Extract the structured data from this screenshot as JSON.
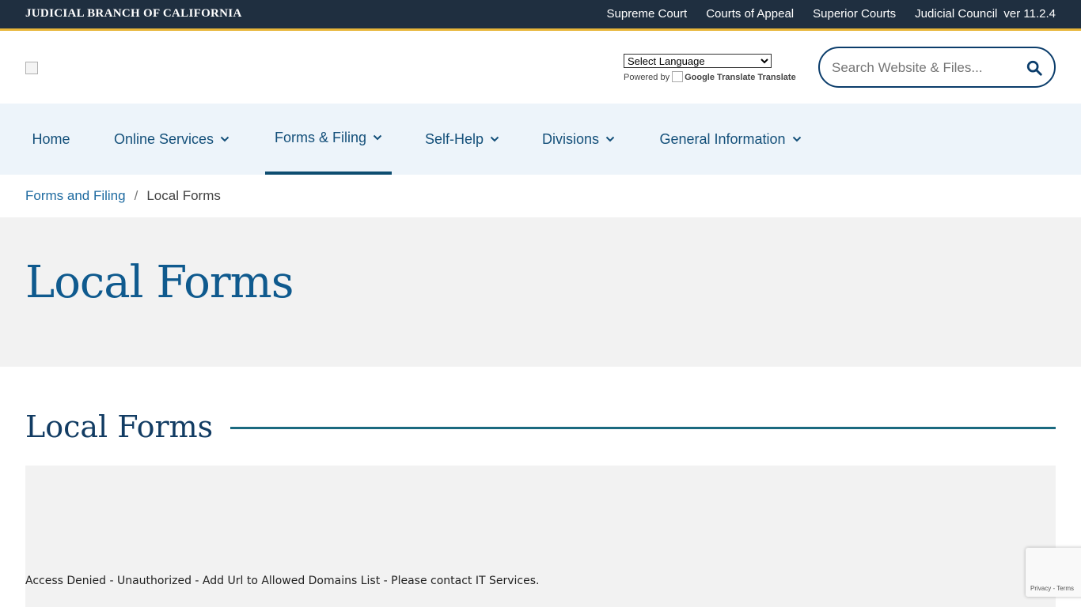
{
  "topbar": {
    "brand": "JUDICIAL BRANCH OF CALIFORNIA",
    "links": [
      "Supreme Court",
      "Courts of Appeal",
      "Superior Courts",
      "Judicial Council"
    ],
    "version": "ver 11.2.4",
    "background": "#1f2f40",
    "accent": "#e8b63a"
  },
  "translate": {
    "select_value": "Select Language",
    "powered_by": "Powered by",
    "google_label": "Google Translate",
    "translate_label": "Translate"
  },
  "search": {
    "placeholder": "Search Website & Files...",
    "icon": "search-icon"
  },
  "nav": {
    "items": [
      {
        "label": "Home"
      },
      {
        "label": "Online Services"
      },
      {
        "label": "Forms & Filing"
      },
      {
        "label": "Self-Help"
      },
      {
        "label": "Divisions"
      },
      {
        "label": "General Information"
      }
    ],
    "active": "Forms & Filing"
  },
  "breadcrumb": {
    "parent": "Forms and Filing",
    "separator": "/",
    "current": "Local Forms"
  },
  "hero": {
    "title": "Local Forms"
  },
  "section": {
    "title": "Local Forms"
  },
  "content": {
    "message": "Access Denied - Unauthorized - Add Url to Allowed Domains List - Please contact IT Services."
  },
  "recaptcha": {
    "privacy": "Privacy",
    "separator": "-",
    "terms": "Terms"
  }
}
